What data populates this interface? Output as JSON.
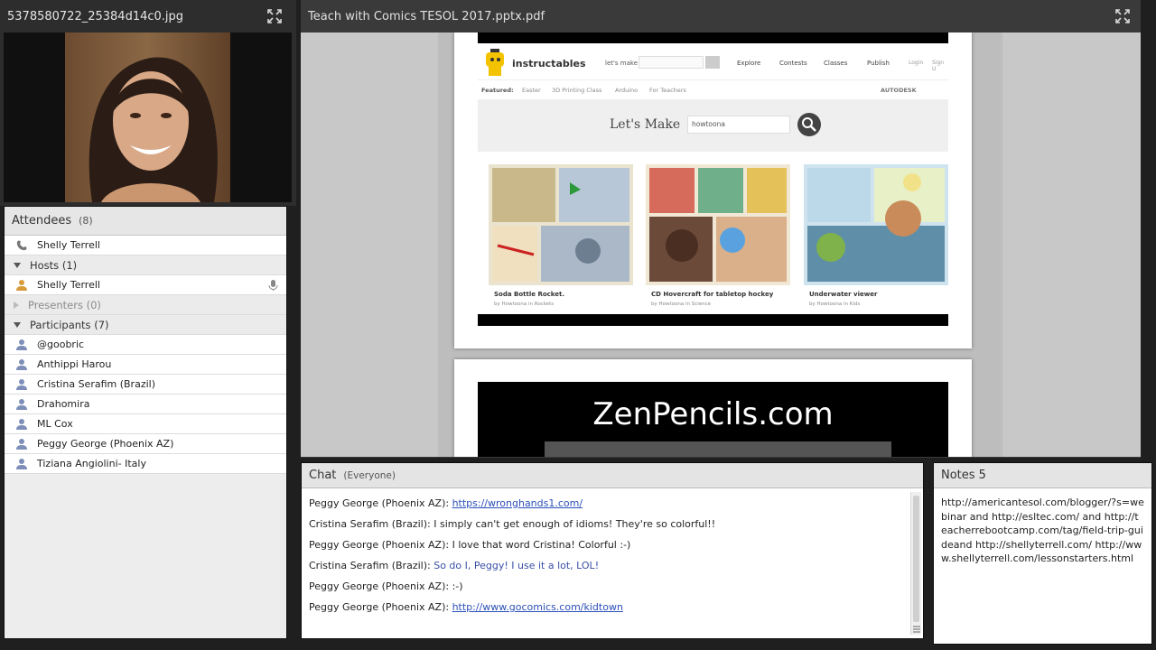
{
  "camera_pod": {
    "title": "5378580722_25384d14c0.jpg"
  },
  "attendees": {
    "title": "Attendees",
    "count": "(8)",
    "presenter_phone": "Shelly Terrell",
    "hosts_label": "Hosts (1)",
    "hosts": [
      "Shelly Terrell"
    ],
    "presenters_label": "Presenters (0)",
    "participants_label": "Participants (7)",
    "participants": [
      "@goobric",
      "Anthippi Harou",
      "Cristina Serafim (Brazil)",
      "Drahomira",
      "ML Cox",
      "Peggy George (Phoenix AZ)",
      "Tiziana  Angiolini- Italy"
    ]
  },
  "share_pod": {
    "title": "Teach with Comics TESOL 2017.pptx.pdf",
    "slide1": {
      "brand": "instructables",
      "lets_make_small": "let's make",
      "nav": [
        "Explore",
        "Contests",
        "Classes",
        "Publish"
      ],
      "login": "Login",
      "signup": "Sign U",
      "featured_label": "Featured:",
      "featured_items": [
        "Easter",
        "3D Printing Class",
        "Arduino",
        "For Teachers"
      ],
      "autodesk": "AUTODESK",
      "lets_make_big": "Let's Make",
      "search_value": "howtoona",
      "cards": [
        {
          "title": "Soda Bottle Rocket.",
          "byline": "by Howtoona in Rockets"
        },
        {
          "title": "CD Hovercraft for tabletop hockey",
          "byline": "by Howtoona in Science"
        },
        {
          "title": "Underwater viewer",
          "byline": "by Howtoona in Kids"
        }
      ]
    },
    "slide2": {
      "heading": "ZenPencils.com"
    }
  },
  "chat": {
    "title": "Chat",
    "audience": "(Everyone)",
    "messages": [
      {
        "who": "Peggy George (Phoenix AZ):",
        "text": "https://wronghands1.com/",
        "type": "link"
      },
      {
        "who": "Cristina Serafim (Brazil):",
        "text": "I simply can't get enough of idioms! They're so colorful!!",
        "type": "plain"
      },
      {
        "who": "Peggy George (Phoenix AZ):",
        "text": "I love that word Cristina! Colorful :-)",
        "type": "plain"
      },
      {
        "who": "Cristina Serafim (Brazil):",
        "text": "So do I, Peggy! I use it a lot, LOL!",
        "type": "blue"
      },
      {
        "who": "Peggy George (Phoenix AZ):",
        "text": ":-)",
        "type": "plain"
      },
      {
        "who": "Peggy George (Phoenix AZ):",
        "text": "http://www.gocomics.com/kidtown",
        "type": "link"
      }
    ]
  },
  "notes": {
    "title": "Notes 5",
    "text": "http://americantesol.com/blogger/?s=webinar and http://esltec.com/ and http://teacherrebootcamp.com/tag/field-trip-guideand http://shellyterrell.com/ http://www.shellyterrell.com/lessonstarters.html"
  }
}
